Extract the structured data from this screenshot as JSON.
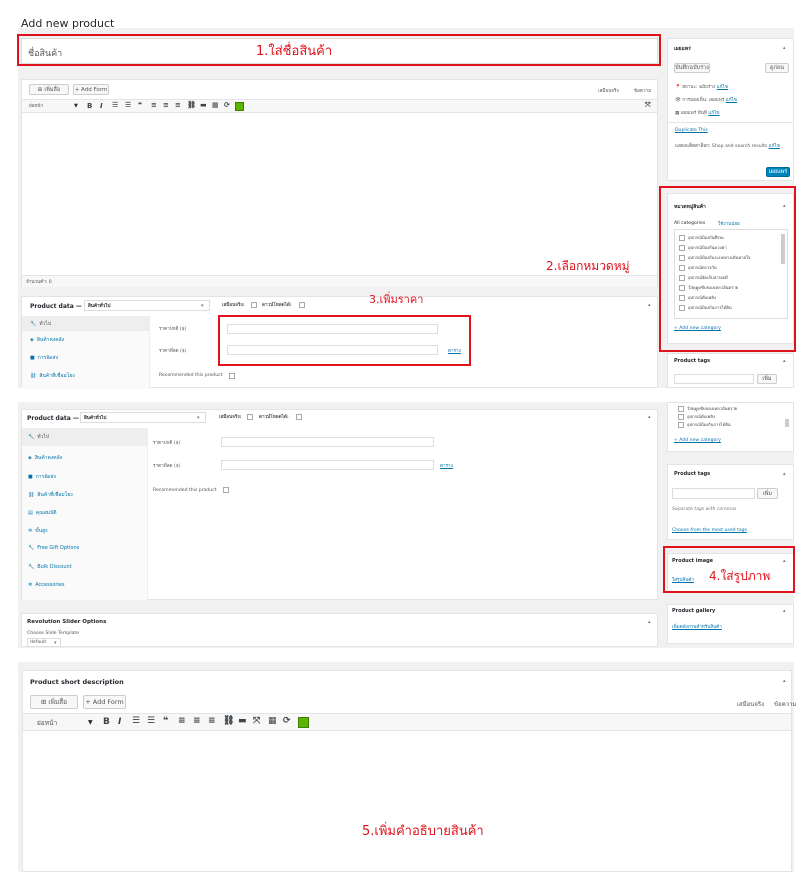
{
  "page": {
    "title": "Add new product"
  },
  "title_field": {
    "value": "ชื่อสินค้า"
  },
  "editor": {
    "add_media": "เพิ่มสื่อ",
    "add_form": "+ Add Form",
    "tab_visual": "เสมือนจริง",
    "tab_text": "ข้อความ",
    "format_select": "ย่อหน้า",
    "word_count": "จำนวนคำ: 0"
  },
  "product_data": {
    "label": "Product data —",
    "type_select": "สินค้าทั่วไป",
    "virtual_label": "เสมือนจริง:",
    "downloadable_label": "ดาวน์โหลดได้:",
    "tabs": [
      {
        "label": "ทั่วไป",
        "icon": "wrench-icon"
      },
      {
        "label": "สินค้าคงคลัง",
        "icon": "inventory-icon"
      },
      {
        "label": "การจัดส่ง",
        "icon": "truck-icon"
      },
      {
        "label": "สินค้าที่เชื่อมโยง",
        "icon": "link-icon"
      },
      {
        "label": "คุณสมบัติ",
        "icon": "attributes-icon"
      },
      {
        "label": "ขั้นสูง",
        "icon": "gear-icon"
      },
      {
        "label": "Free Gift Options",
        "icon": "wrench-icon"
      },
      {
        "label": "Bulk Discount",
        "icon": "wrench-icon"
      },
      {
        "label": "Accessories",
        "icon": "gear-icon"
      }
    ],
    "regular_price_label": "ราคาปกติ ($)",
    "sale_price_label": "ราคาที่ลด ($)",
    "schedule_link": "ตาราง",
    "recommended_label": "Recommended this product"
  },
  "publish_box": {
    "title": "เผยแพร่",
    "save_draft": "บันทึกฉบับร่าง",
    "preview": "ดูก่อน",
    "status_label": "สถานะ: ฉบับร่าง",
    "visibility_label": "การมองเห็น: เผยแพร่",
    "publish_time_label": "เผยแพร่ ทันที",
    "edit_link": "แก้ไข",
    "duplicate": "Duplicate This",
    "catalog_visibility": "แสดงแค็ตตาล็อก: Shop and search results",
    "publish_button": "เผยแพร่"
  },
  "categories_box": {
    "title": "หมวดหมู่สินค้า",
    "tab_all": "All categories",
    "tab_most_used": "ใช้งานบ่อย",
    "items": [
      "อุปกรณ์ป้องกันศีรษะ",
      "อุปกรณ์ป้องกันดวงตา",
      "อุปกรณ์ป้องกันระบบทางเดินหายใจ",
      "อุปกรณ์ตรวจวัด",
      "อุปกรณ์จัดเก็บสารเคมี",
      "วัสดุดูดซับของเหลวอันตราย",
      "อุปกรณ์ดับเพลิง",
      "อุปกรณ์ป้องกันการได้ยิน"
    ],
    "add_new": "+ Add new category"
  },
  "tags_box": {
    "title": "Product tags",
    "add_button": "เพิ่ม",
    "hint": "Separate tags with commas",
    "choose_link": "Choose from the most used tags"
  },
  "image_box": {
    "title": "Product image",
    "set_link": "ใส่รูปสินค้า"
  },
  "gallery_box": {
    "title": "Product gallery",
    "add_link": "เพิ่มคลังภาพสำหรับสินค้า"
  },
  "revolution": {
    "title": "Revolution Slider Options",
    "choose_label": "Choose Slide Template",
    "select_value": "default"
  },
  "short_desc": {
    "title": "Product short description"
  },
  "annotations": {
    "step1": "1.ใส่ชื่อสินค้า",
    "step2": "2.เลือกหมวดหมู่",
    "step3": "3.เพิ่มราคา",
    "step4": "4.ใส่รูปภาพ",
    "step5": "5.เพิ่มคำอธิบายสินค้า",
    "color": "#e0121b"
  }
}
